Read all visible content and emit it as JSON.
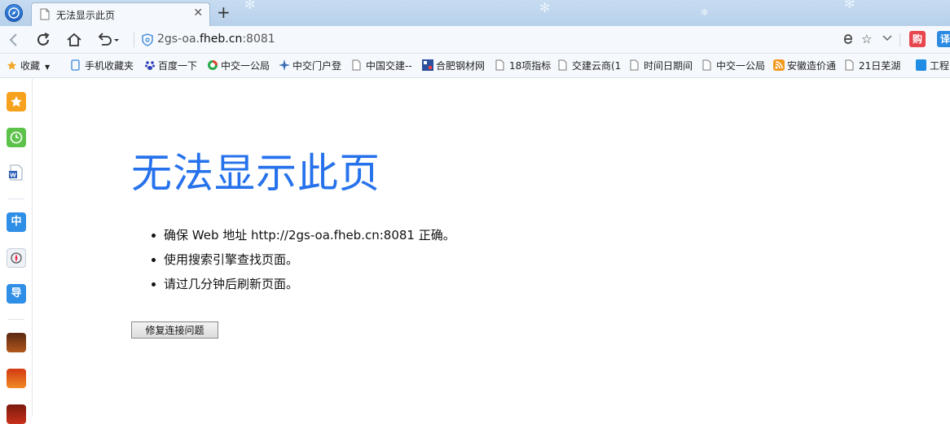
{
  "browser": {
    "tab": {
      "title": "无法显示此页",
      "close_glyph": "✕"
    },
    "new_tab_glyph": "+",
    "address": {
      "scheme_host": "2gs-oa.",
      "host_main": "fheb.cn",
      "port": ":8081"
    },
    "promo_buy": "购",
    "promo_translate": "译"
  },
  "bookmarks": {
    "favorites_label": "收藏",
    "items": [
      "手机收藏夹",
      "百度一下",
      "中交一公局",
      "中交门户登",
      "中国交建--",
      "合肥钢材网",
      "18项指标",
      "交建云商(1",
      "时间日期间",
      "中交一公局",
      "安徽造价通",
      "21日芜湖",
      "工程"
    ]
  },
  "sidebar": {
    "labels": {
      "zhong": "中",
      "dao": "导"
    }
  },
  "error_page": {
    "title": "无法显示此页",
    "bullets": [
      "确保 Web 地址 http://2gs-oa.fheb.cn:8081 正确。",
      "使用搜索引擎查找页面。",
      "请过几分钟后刷新页面。"
    ],
    "fix_button": "修复连接问题"
  },
  "colors": {
    "title_blue": "#2672ec",
    "tabstrip": "#c7dcf1",
    "toolbar": "#f5f9fd"
  }
}
